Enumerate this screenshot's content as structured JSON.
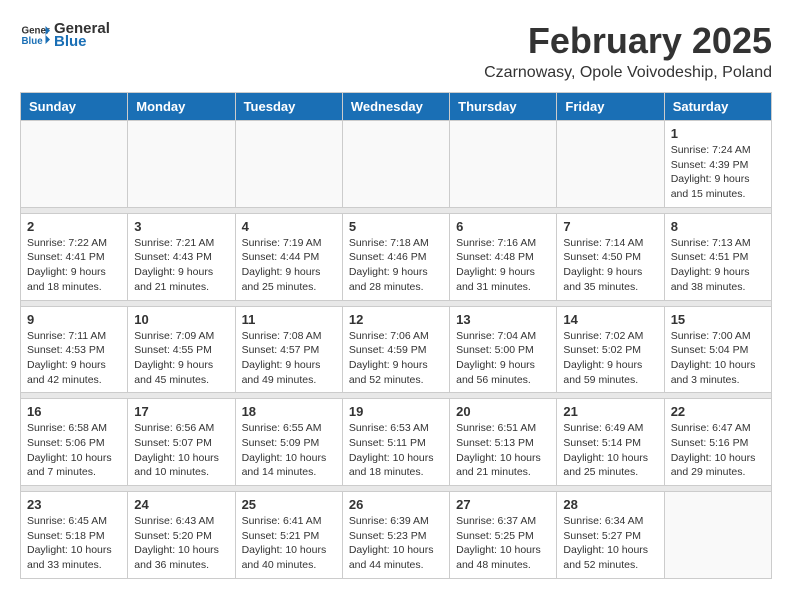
{
  "header": {
    "logo_general": "General",
    "logo_blue": "Blue",
    "title": "February 2025",
    "location": "Czarnowasy, Opole Voivodeship, Poland"
  },
  "weekdays": [
    "Sunday",
    "Monday",
    "Tuesday",
    "Wednesday",
    "Thursday",
    "Friday",
    "Saturday"
  ],
  "weeks": [
    {
      "days": [
        {
          "num": "",
          "info": ""
        },
        {
          "num": "",
          "info": ""
        },
        {
          "num": "",
          "info": ""
        },
        {
          "num": "",
          "info": ""
        },
        {
          "num": "",
          "info": ""
        },
        {
          "num": "",
          "info": ""
        },
        {
          "num": "1",
          "info": "Sunrise: 7:24 AM\nSunset: 4:39 PM\nDaylight: 9 hours and 15 minutes."
        }
      ]
    },
    {
      "days": [
        {
          "num": "2",
          "info": "Sunrise: 7:22 AM\nSunset: 4:41 PM\nDaylight: 9 hours and 18 minutes."
        },
        {
          "num": "3",
          "info": "Sunrise: 7:21 AM\nSunset: 4:43 PM\nDaylight: 9 hours and 21 minutes."
        },
        {
          "num": "4",
          "info": "Sunrise: 7:19 AM\nSunset: 4:44 PM\nDaylight: 9 hours and 25 minutes."
        },
        {
          "num": "5",
          "info": "Sunrise: 7:18 AM\nSunset: 4:46 PM\nDaylight: 9 hours and 28 minutes."
        },
        {
          "num": "6",
          "info": "Sunrise: 7:16 AM\nSunset: 4:48 PM\nDaylight: 9 hours and 31 minutes."
        },
        {
          "num": "7",
          "info": "Sunrise: 7:14 AM\nSunset: 4:50 PM\nDaylight: 9 hours and 35 minutes."
        },
        {
          "num": "8",
          "info": "Sunrise: 7:13 AM\nSunset: 4:51 PM\nDaylight: 9 hours and 38 minutes."
        }
      ]
    },
    {
      "days": [
        {
          "num": "9",
          "info": "Sunrise: 7:11 AM\nSunset: 4:53 PM\nDaylight: 9 hours and 42 minutes."
        },
        {
          "num": "10",
          "info": "Sunrise: 7:09 AM\nSunset: 4:55 PM\nDaylight: 9 hours and 45 minutes."
        },
        {
          "num": "11",
          "info": "Sunrise: 7:08 AM\nSunset: 4:57 PM\nDaylight: 9 hours and 49 minutes."
        },
        {
          "num": "12",
          "info": "Sunrise: 7:06 AM\nSunset: 4:59 PM\nDaylight: 9 hours and 52 minutes."
        },
        {
          "num": "13",
          "info": "Sunrise: 7:04 AM\nSunset: 5:00 PM\nDaylight: 9 hours and 56 minutes."
        },
        {
          "num": "14",
          "info": "Sunrise: 7:02 AM\nSunset: 5:02 PM\nDaylight: 9 hours and 59 minutes."
        },
        {
          "num": "15",
          "info": "Sunrise: 7:00 AM\nSunset: 5:04 PM\nDaylight: 10 hours and 3 minutes."
        }
      ]
    },
    {
      "days": [
        {
          "num": "16",
          "info": "Sunrise: 6:58 AM\nSunset: 5:06 PM\nDaylight: 10 hours and 7 minutes."
        },
        {
          "num": "17",
          "info": "Sunrise: 6:56 AM\nSunset: 5:07 PM\nDaylight: 10 hours and 10 minutes."
        },
        {
          "num": "18",
          "info": "Sunrise: 6:55 AM\nSunset: 5:09 PM\nDaylight: 10 hours and 14 minutes."
        },
        {
          "num": "19",
          "info": "Sunrise: 6:53 AM\nSunset: 5:11 PM\nDaylight: 10 hours and 18 minutes."
        },
        {
          "num": "20",
          "info": "Sunrise: 6:51 AM\nSunset: 5:13 PM\nDaylight: 10 hours and 21 minutes."
        },
        {
          "num": "21",
          "info": "Sunrise: 6:49 AM\nSunset: 5:14 PM\nDaylight: 10 hours and 25 minutes."
        },
        {
          "num": "22",
          "info": "Sunrise: 6:47 AM\nSunset: 5:16 PM\nDaylight: 10 hours and 29 minutes."
        }
      ]
    },
    {
      "days": [
        {
          "num": "23",
          "info": "Sunrise: 6:45 AM\nSunset: 5:18 PM\nDaylight: 10 hours and 33 minutes."
        },
        {
          "num": "24",
          "info": "Sunrise: 6:43 AM\nSunset: 5:20 PM\nDaylight: 10 hours and 36 minutes."
        },
        {
          "num": "25",
          "info": "Sunrise: 6:41 AM\nSunset: 5:21 PM\nDaylight: 10 hours and 40 minutes."
        },
        {
          "num": "26",
          "info": "Sunrise: 6:39 AM\nSunset: 5:23 PM\nDaylight: 10 hours and 44 minutes."
        },
        {
          "num": "27",
          "info": "Sunrise: 6:37 AM\nSunset: 5:25 PM\nDaylight: 10 hours and 48 minutes."
        },
        {
          "num": "28",
          "info": "Sunrise: 6:34 AM\nSunset: 5:27 PM\nDaylight: 10 hours and 52 minutes."
        },
        {
          "num": "",
          "info": ""
        }
      ]
    }
  ]
}
